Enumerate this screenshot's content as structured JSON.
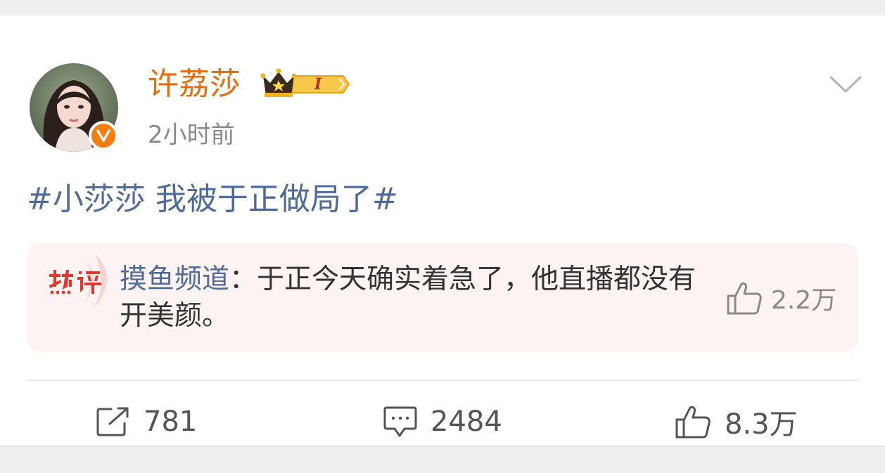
{
  "post": {
    "username": "许荔莎",
    "vip_level": "I",
    "timestamp": "2小时前",
    "topic": "#小莎莎 我被于正做局了#"
  },
  "hot_comment": {
    "badge_icon": "hot-comment-icon",
    "author": "摸鱼频道",
    "separator": "：",
    "text": "于正今天确实着急了，他直播都没有开美颜。",
    "likes": "2.2万"
  },
  "actions": {
    "repost_count": "781",
    "comment_count": "2484",
    "like_count": "8.3万"
  },
  "colors": {
    "username": "#e86b0c",
    "topic": "#4e6b9a",
    "hot_box_bg": "#fdf3f2",
    "verified_badge": "#f77d0e"
  }
}
